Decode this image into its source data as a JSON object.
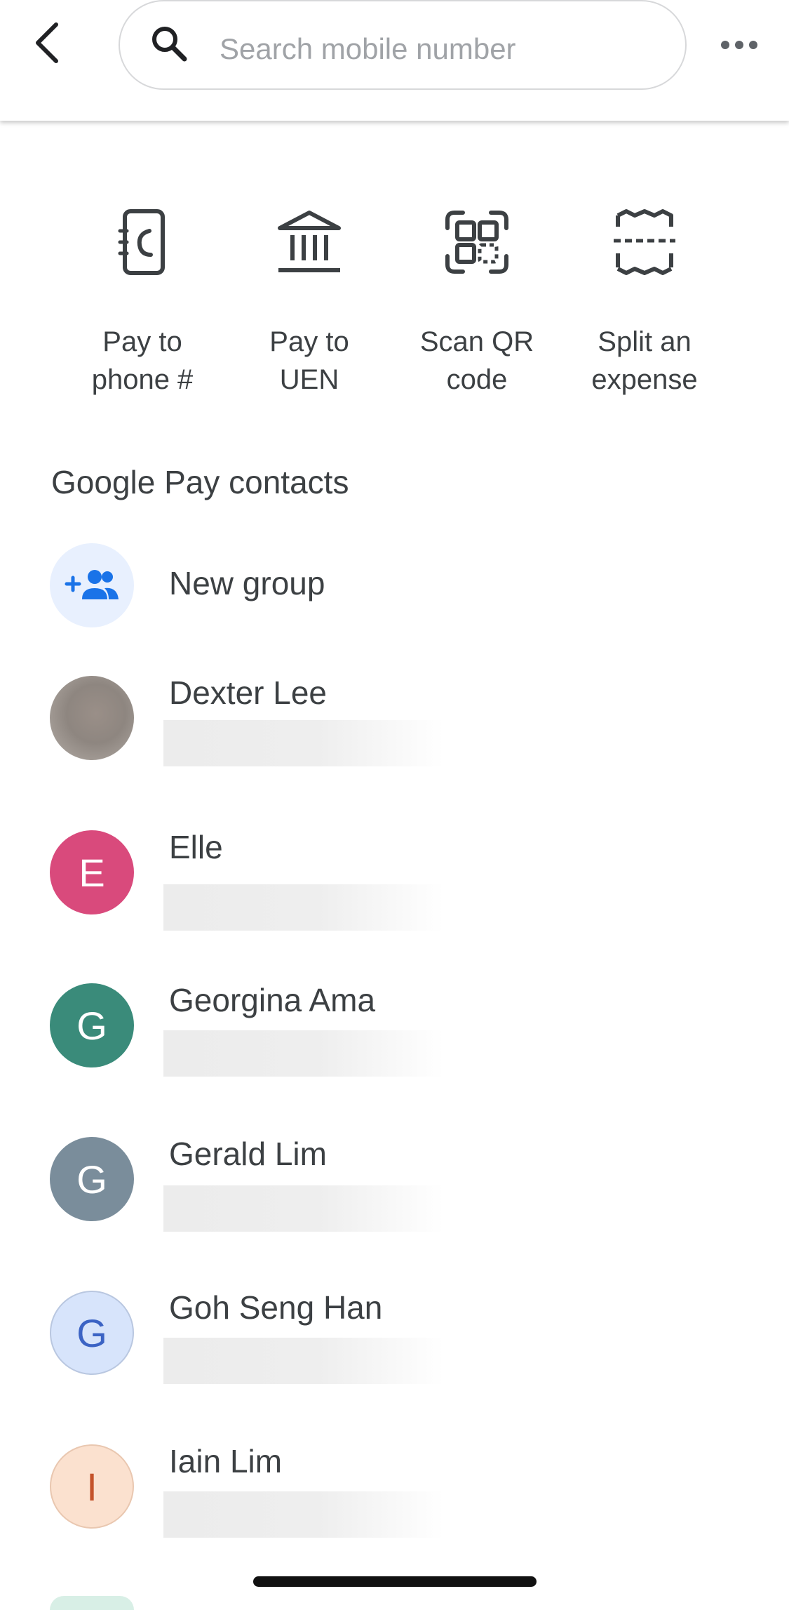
{
  "header": {
    "search_placeholder": "Search mobile number",
    "icons": {
      "back": "arrow-back-icon",
      "search": "search-icon",
      "more": "more-horiz-icon"
    }
  },
  "actions": [
    {
      "label": "Pay to\nphone #",
      "icon": "phone-book-icon"
    },
    {
      "label": "Pay to\nUEN",
      "icon": "bank-icon"
    },
    {
      "label": "Scan QR\ncode",
      "icon": "qr-scan-icon"
    },
    {
      "label": "Split an\nexpense",
      "icon": "receipt-icon"
    }
  ],
  "contacts_section": {
    "title": "Google Pay contacts",
    "new_group_label": "New group",
    "new_group_icon": "group-add-icon"
  },
  "contacts": [
    {
      "name": "Dexter Lee",
      "initial": "",
      "avatar_type": "photo"
    },
    {
      "name": "Elle",
      "initial": "E",
      "avatar_color": "#d94a7c",
      "text_color": "#ffffff"
    },
    {
      "name": "Georgina Ama",
      "initial": "G",
      "avatar_color": "#3a8b7a",
      "text_color": "#ffffff"
    },
    {
      "name": "Gerald Lim",
      "initial": "G",
      "avatar_color": "#7a8d9b",
      "text_color": "#ffffff"
    },
    {
      "name": "Goh Seng Han",
      "initial": "G",
      "avatar_color": "#d7e4fb",
      "text_color": "#3b63c4"
    },
    {
      "name": "Iain Lim",
      "initial": "I",
      "avatar_color": "#fbe1cf",
      "text_color": "#c4522a"
    }
  ],
  "colors": {
    "accent_blue": "#1a73e8",
    "new_group_bg": "#e8f0fe",
    "text_primary": "#3c4043"
  }
}
